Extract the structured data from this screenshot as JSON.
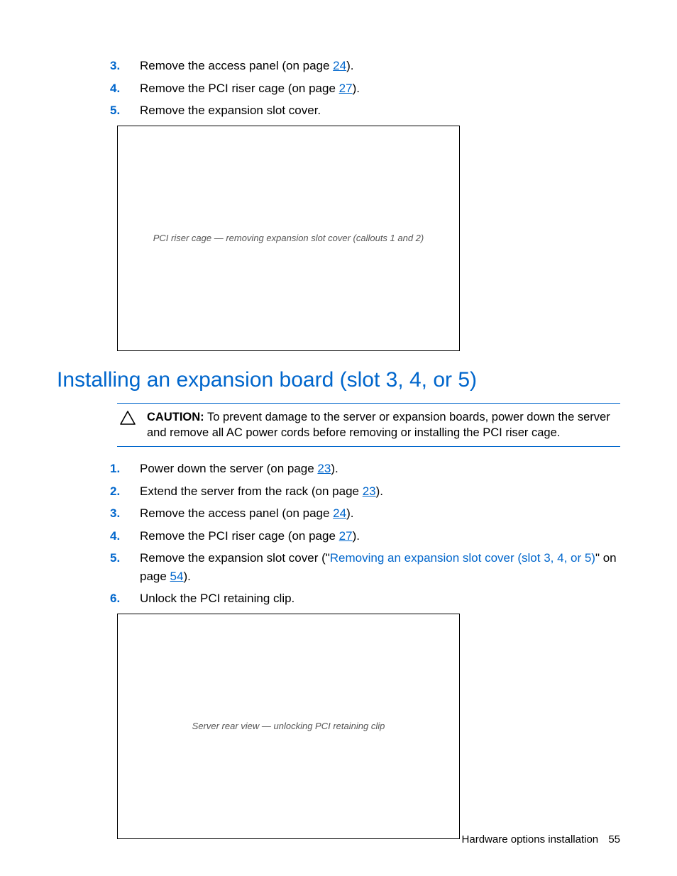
{
  "top_steps": [
    {
      "num": "3.",
      "prefix": "Remove the access panel (on page ",
      "page_link": "24",
      "suffix": ")."
    },
    {
      "num": "4.",
      "prefix": "Remove the PCI riser cage (on page ",
      "page_link": "27",
      "suffix": ")."
    },
    {
      "num": "5.",
      "prefix": "Remove the expansion slot cover.",
      "page_link": "",
      "suffix": ""
    }
  ],
  "figure1_alt": "PCI riser cage — removing expansion slot cover (callouts 1 and 2)",
  "heading": "Installing an expansion board (slot 3, 4, or 5)",
  "caution": {
    "label": "CAUTION:",
    "text": "To prevent damage to the server or expansion boards, power down the server and remove all AC power cords before removing or installing the PCI riser cage."
  },
  "bottom_steps": [
    {
      "num": "1.",
      "prefix": "Power down the server (on page ",
      "page_link": "23",
      "suffix": ")."
    },
    {
      "num": "2.",
      "prefix": "Extend the server from the rack (on page ",
      "page_link": "23",
      "suffix": ")."
    },
    {
      "num": "3.",
      "prefix": "Remove the access panel (on page ",
      "page_link": "24",
      "suffix": ")."
    },
    {
      "num": "4.",
      "prefix": "Remove the PCI riser cage (on page ",
      "page_link": "27",
      "suffix": ")."
    },
    {
      "num": "5.",
      "prefix": "Remove the expansion slot cover (\"",
      "xref": "Removing an expansion slot cover (slot 3, 4, or 5)",
      "mid": "\" on page ",
      "page_link": "54",
      "suffix": ")."
    },
    {
      "num": "6.",
      "prefix": "Unlock the PCI retaining clip.",
      "page_link": "",
      "suffix": ""
    }
  ],
  "figure2_alt": "Server rear view — unlocking PCI retaining clip",
  "footer": {
    "section": "Hardware options installation",
    "page": "55"
  }
}
